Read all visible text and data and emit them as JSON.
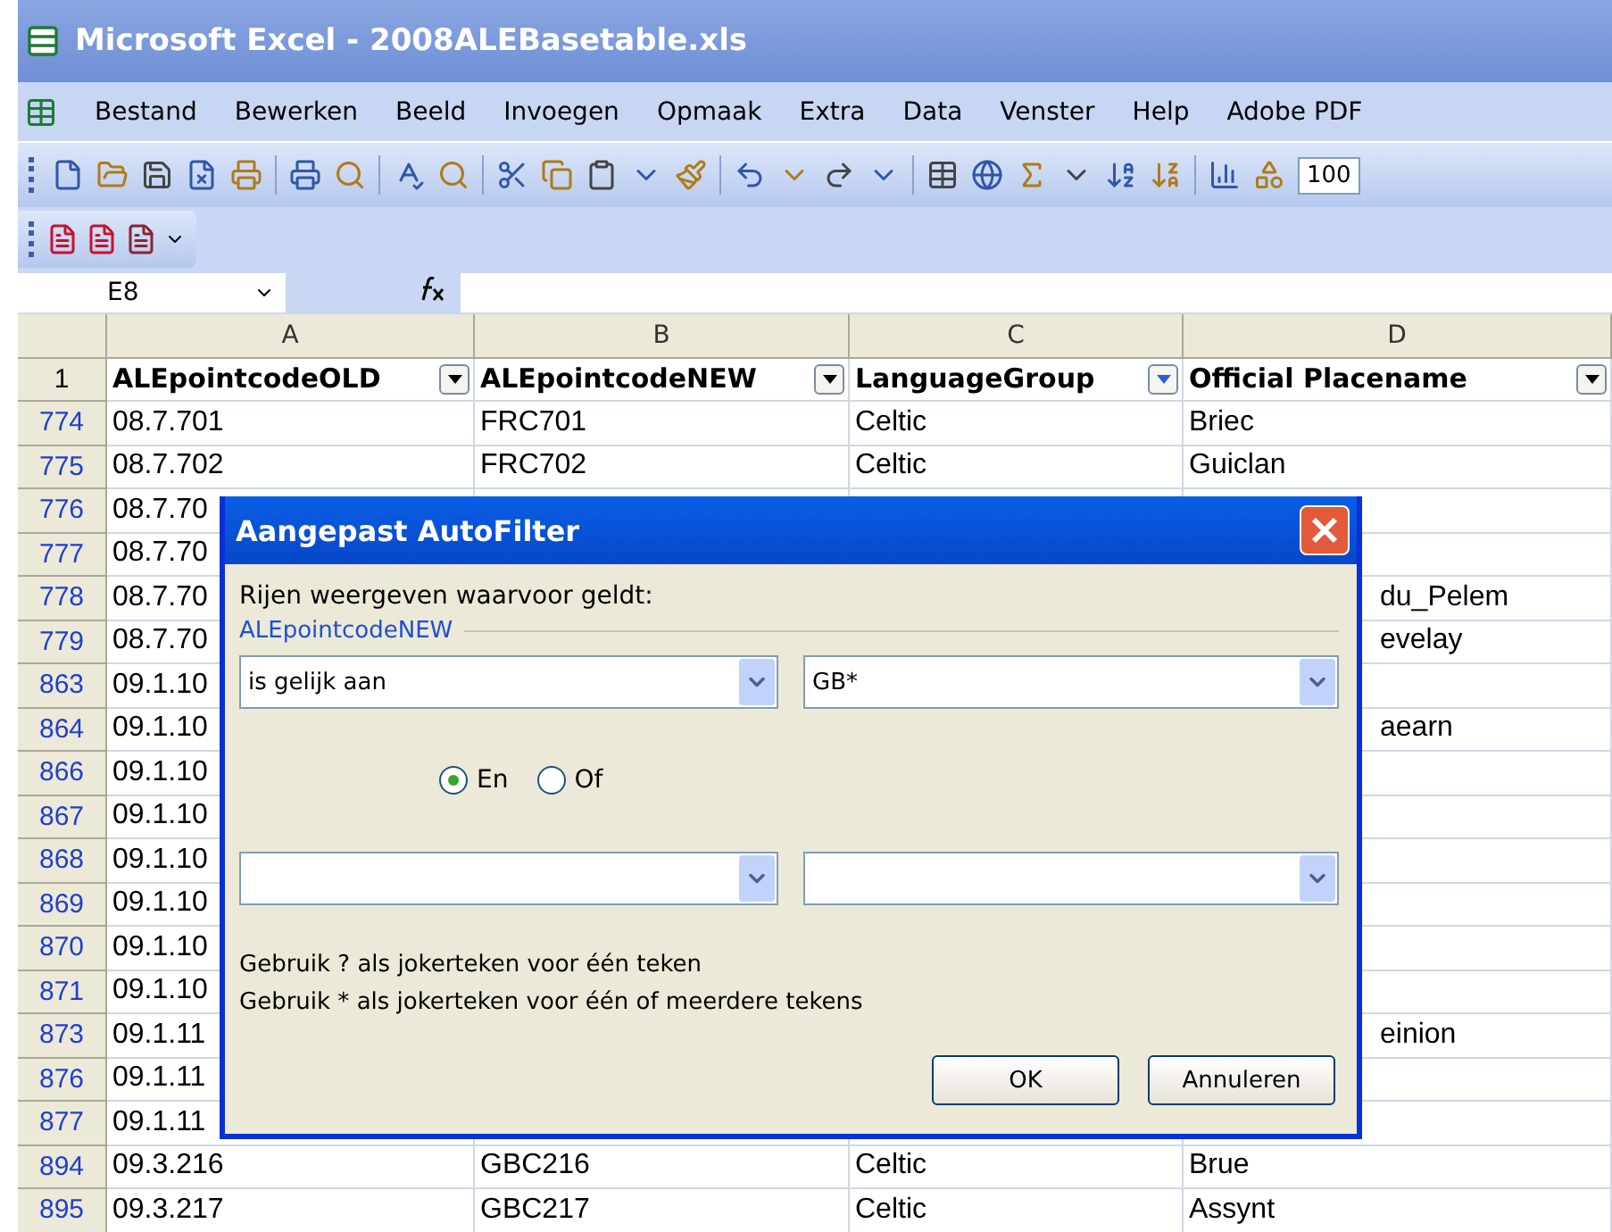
{
  "window": {
    "title": "Microsoft Excel - 2008ALEBasetable.xls"
  },
  "menu": [
    "Bestand",
    "Bewerken",
    "Beeld",
    "Invoegen",
    "Opmaak",
    "Extra",
    "Data",
    "Venster",
    "Help",
    "Adobe PDF"
  ],
  "toolbar": {
    "zoom": "100"
  },
  "formula_bar": {
    "name_box": "E8"
  },
  "columns": [
    "A",
    "B",
    "C",
    "D"
  ],
  "header_row": {
    "number": "1",
    "cells": [
      {
        "text": "ALEpointcodeOLD",
        "filter_active": false
      },
      {
        "text": "ALEpointcodeNEW",
        "filter_active": false
      },
      {
        "text": "LanguageGroup",
        "filter_active": true
      },
      {
        "text": "Official Placename",
        "filter_active": false
      }
    ]
  },
  "rows": [
    {
      "number": "774",
      "covered": false,
      "cells": [
        "08.7.701",
        "FRC701",
        "Celtic",
        "Briec"
      ]
    },
    {
      "number": "775",
      "covered": false,
      "cells": [
        "08.7.702",
        "FRC702",
        "Celtic",
        "Guiclan"
      ]
    },
    {
      "number": "776",
      "covered": true,
      "cells": [
        "08.7.70"
      ]
    },
    {
      "number": "777",
      "covered": true,
      "cells": [
        "08.7.70"
      ]
    },
    {
      "number": "778",
      "covered": true,
      "cells": [
        "08.7.70",
        "du_Pelem"
      ]
    },
    {
      "number": "779",
      "covered": true,
      "cells": [
        "08.7.70",
        "evelay"
      ]
    },
    {
      "number": "863",
      "covered": true,
      "cells": [
        "09.1.10"
      ]
    },
    {
      "number": "864",
      "covered": true,
      "cells": [
        "09.1.10",
        "aearn"
      ]
    },
    {
      "number": "866",
      "covered": true,
      "cells": [
        "09.1.10"
      ]
    },
    {
      "number": "867",
      "covered": true,
      "cells": [
        "09.1.10"
      ]
    },
    {
      "number": "868",
      "covered": true,
      "cells": [
        "09.1.10"
      ]
    },
    {
      "number": "869",
      "covered": true,
      "cells": [
        "09.1.10"
      ]
    },
    {
      "number": "870",
      "covered": true,
      "cells": [
        "09.1.10"
      ]
    },
    {
      "number": "871",
      "covered": true,
      "cells": [
        "09.1.10"
      ]
    },
    {
      "number": "873",
      "covered": true,
      "cells": [
        "09.1.11",
        "einion"
      ]
    },
    {
      "number": "876",
      "covered": true,
      "cells": [
        "09.1.11"
      ]
    },
    {
      "number": "877",
      "covered": true,
      "cells": [
        "09.1.11"
      ]
    },
    {
      "number": "894",
      "covered": false,
      "cells": [
        "09.3.216",
        "GBC216",
        "Celtic",
        "Brue"
      ]
    },
    {
      "number": "895",
      "covered": false,
      "cells": [
        "09.3.217",
        "GBC217",
        "Celtic",
        "Assynt"
      ]
    }
  ],
  "dialog": {
    "title": "Aangepast AutoFilter",
    "intro": "Rijen weergeven waarvoor geldt:",
    "field": "ALEpointcodeNEW",
    "criteria": [
      {
        "kind": "filled",
        "operator": "is gelijk aan",
        "value": "GB*"
      },
      {
        "kind": "blank"
      }
    ],
    "joins": [
      {
        "label": "En",
        "selected": true
      },
      {
        "label": "Of",
        "selected": false
      }
    ],
    "hints": [
      "Gebruik ? als jokerteken voor één teken",
      "Gebruik * als jokerteken voor één of meerdere tekens"
    ],
    "buttons": [
      "OK",
      "Annuleren"
    ]
  }
}
